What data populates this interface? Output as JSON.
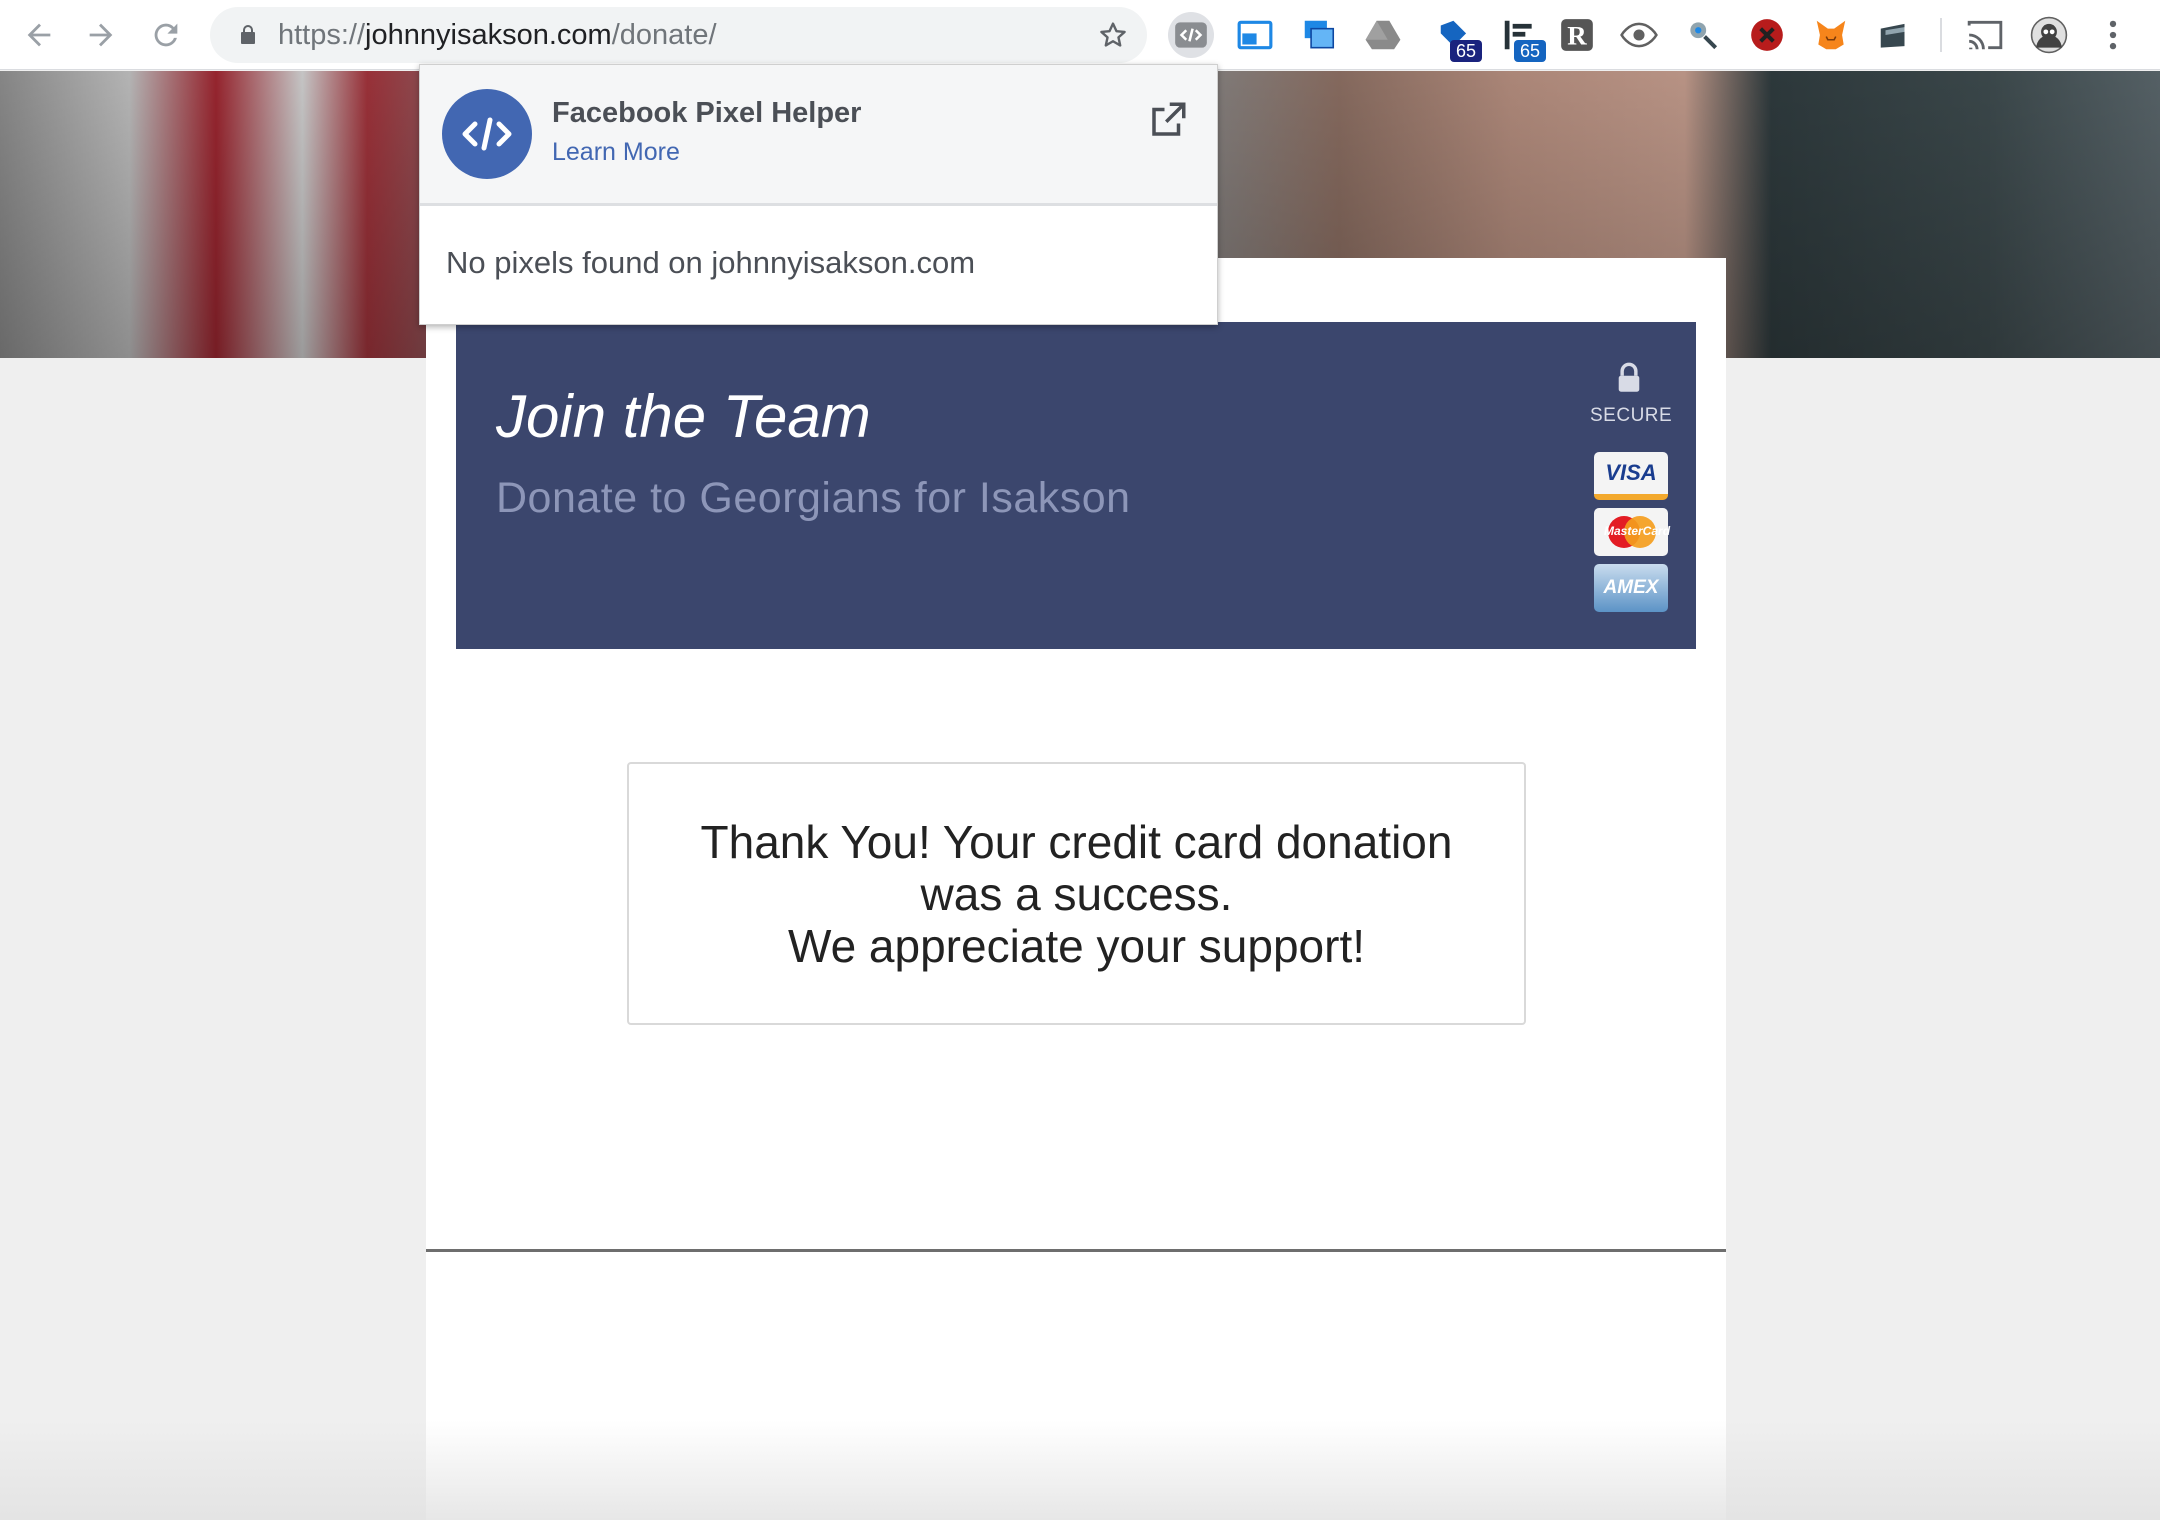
{
  "browser": {
    "url_scheme": "https://",
    "url_host": "johnnyisakson.com",
    "url_path": "/donate/",
    "extensions": [
      {
        "icon": "facebook-pixel-helper-icon",
        "badge": ""
      },
      {
        "icon": "window-resizer-icon",
        "badge": ""
      },
      {
        "icon": "screenshot-icon",
        "badge": ""
      },
      {
        "icon": "google-drive-icon",
        "badge": ""
      },
      {
        "icon": "tag-assistant-icon",
        "badge": "65"
      },
      {
        "icon": "tracker-icon",
        "badge": "65"
      },
      {
        "icon": "r-icon",
        "badge": ""
      },
      {
        "icon": "eye-icon",
        "badge": ""
      },
      {
        "icon": "satellite-icon",
        "badge": ""
      },
      {
        "icon": "blocker-icon",
        "badge": ""
      },
      {
        "icon": "metamask-fox-icon",
        "badge": ""
      },
      {
        "icon": "wallet-icon",
        "badge": ""
      }
    ]
  },
  "popup": {
    "title": "Facebook Pixel Helper",
    "learn_more": "Learn More",
    "message": "No pixels found on johnnyisakson.com"
  },
  "banner": {
    "title": "Join the Team",
    "subtitle": "Donate to Georgians for Isakson",
    "secure_label": "SECURE",
    "cards": [
      "VISA",
      "MasterCard",
      "AMEX"
    ]
  },
  "confirmation": {
    "line1": "Thank You! Your credit card donation",
    "line2": "was a success.",
    "line3": "We appreciate your support!"
  },
  "colors": {
    "banner_bg": "#3b466d",
    "facebook_blue": "#4267b2",
    "badge_blue": "#1a237e"
  }
}
